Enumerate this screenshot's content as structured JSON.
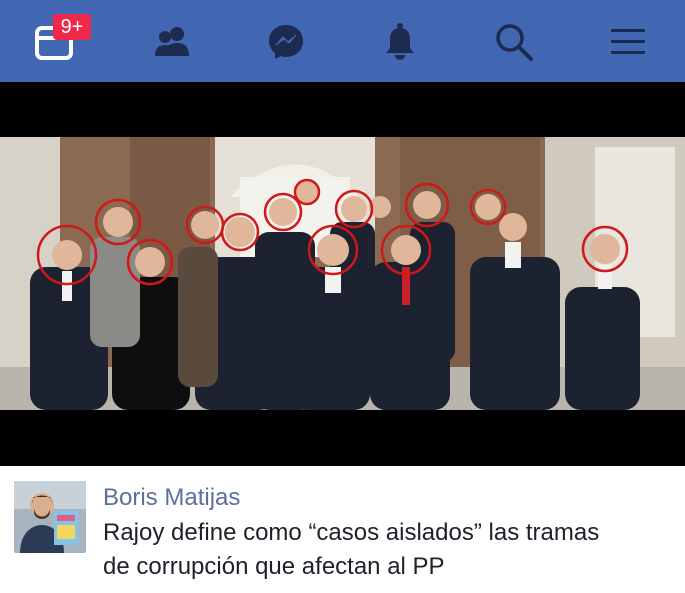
{
  "navbar": {
    "background": "#4267b2",
    "icons": [
      "feed-icon",
      "friends-icon",
      "messenger-icon",
      "notifications-icon",
      "search-icon",
      "menu-icon"
    ],
    "badge": "9+"
  },
  "post": {
    "author": "Boris Matijas",
    "text_line1": "Rajoy define como “casos aislados” las tramas",
    "text_line2": "de corrupción que afectan al PP"
  }
}
